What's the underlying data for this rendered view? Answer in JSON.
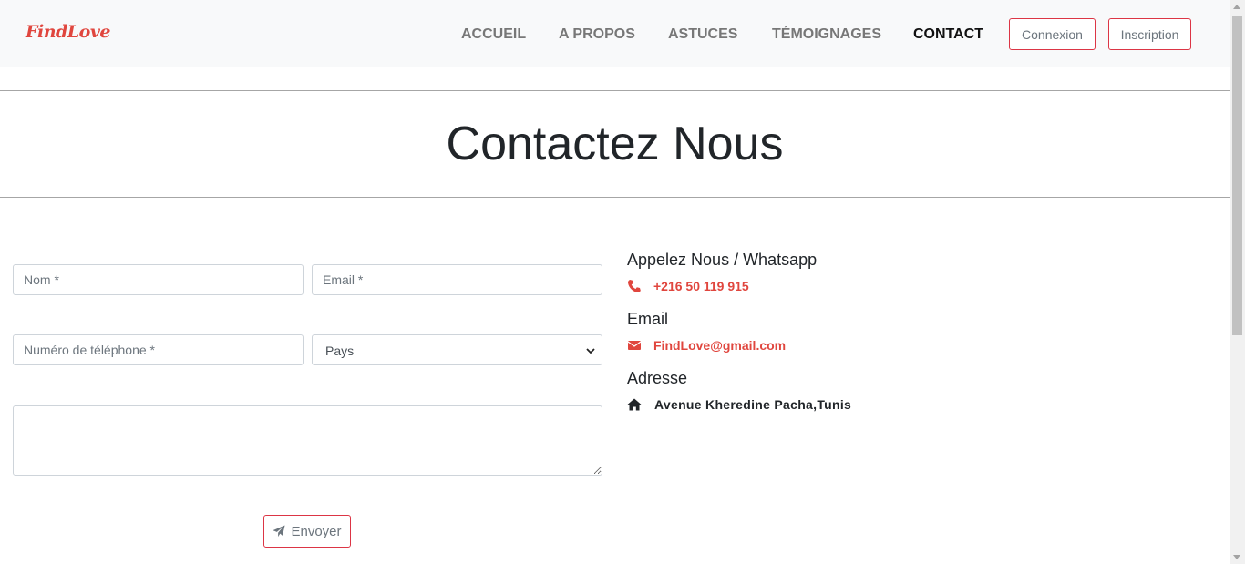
{
  "brand": {
    "name": "FindLove",
    "color": "#e0463e"
  },
  "nav": {
    "links": [
      {
        "label": "ACCUEIL",
        "active": false
      },
      {
        "label": "A PROPOS",
        "active": false
      },
      {
        "label": "ASTUCES",
        "active": false
      },
      {
        "label": "TÉMOIGNAGES",
        "active": false
      },
      {
        "label": "CONTACT",
        "active": true
      }
    ],
    "login_label": "Connexion",
    "signup_label": "Inscription"
  },
  "page": {
    "title": "Contactez Nous"
  },
  "form": {
    "name_placeholder": "Nom *",
    "email_placeholder": "Email *",
    "phone_placeholder": "Numéro de téléphone *",
    "country_selected": "Pays",
    "message_value": "",
    "send_label": "Envoyer",
    "send_icon": "paper-plane-icon"
  },
  "contact": {
    "phone_title": "Appelez Nous / Whatsapp",
    "phone_value": "+216 50 119 915",
    "phone_icon": "phone-icon",
    "email_title": "Email",
    "email_value": "FindLove@gmail.com",
    "email_icon": "envelope-icon",
    "address_title": "Adresse",
    "address_value": "Avenue Kheredine Pacha,Tunis",
    "address_icon": "home-icon"
  },
  "colors": {
    "accent": "#e0463e",
    "border_accent": "#dc3545",
    "navbar_bg": "#f8f9fa"
  }
}
